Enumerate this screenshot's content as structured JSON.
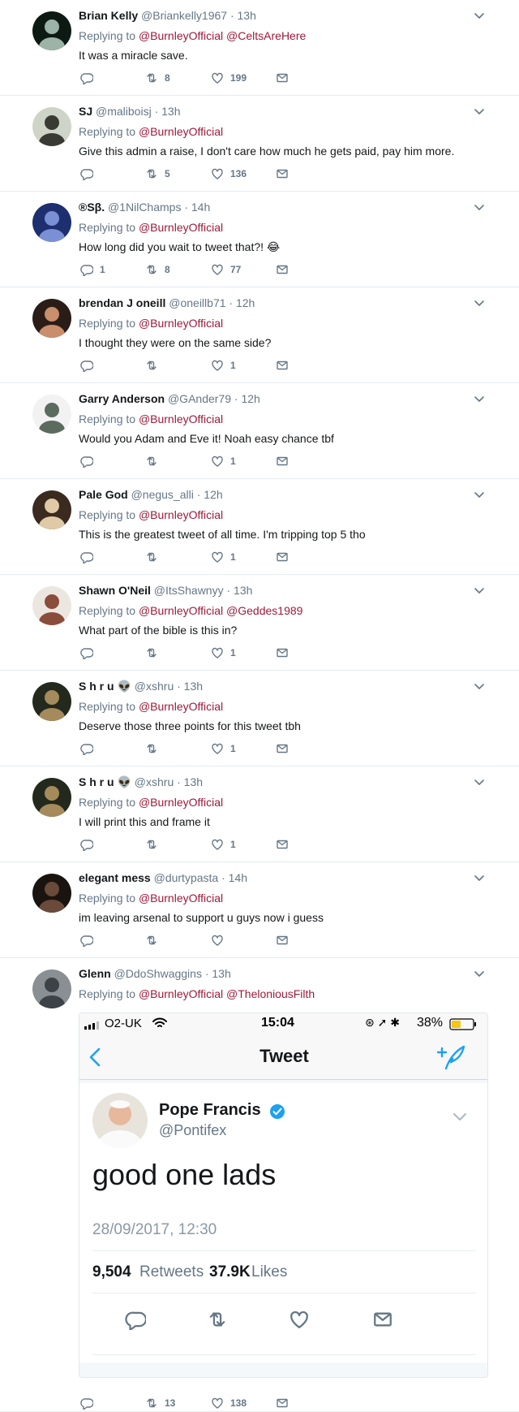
{
  "tweets": [
    {
      "name": "Brian Kelly",
      "handle": "@Briankelly1967 · 13h",
      "replying": "Replying to",
      "mentions": [
        "@BurnleyOfficial",
        "@CeltsAreHere"
      ],
      "text": "It was a miracle save.",
      "replies": "",
      "retweets": "8",
      "likes": "199"
    },
    {
      "name": "SJ",
      "handle": "@maliboisj · 13h",
      "replying": "Replying to",
      "mentions": [
        "@BurnleyOfficial"
      ],
      "text": "Give this admin a raise, I don't care how much he gets paid, pay him more.",
      "replies": "",
      "retweets": "5",
      "likes": "136"
    },
    {
      "name": "®Sβ.",
      "handle": "@1NilChamps · 14h",
      "replying": "Replying to",
      "mentions": [
        "@BurnleyOfficial"
      ],
      "text": "How long did you wait to tweet that?! 😂",
      "replies": "1",
      "retweets": "8",
      "likes": "77"
    },
    {
      "name": "brendan J oneill",
      "handle": "@oneillb71 · 12h",
      "replying": "Replying to",
      "mentions": [
        "@BurnleyOfficial"
      ],
      "text": "I thought they were on the same side?",
      "replies": "",
      "retweets": "",
      "likes": "1"
    },
    {
      "name": "Garry Anderson",
      "handle": "@GAnder79 · 12h",
      "replying": "Replying to",
      "mentions": [
        "@BurnleyOfficial"
      ],
      "text": "Would you Adam and Eve it! Noah easy chance tbf",
      "replies": "",
      "retweets": "",
      "likes": "1"
    },
    {
      "name": "Pale God",
      "handle": "@negus_alli · 12h",
      "replying": "Replying to",
      "mentions": [
        "@BurnleyOfficial"
      ],
      "text": "This is the greatest tweet of all time. I'm tripping top 5 tho",
      "replies": "",
      "retweets": "",
      "likes": "1"
    },
    {
      "name": "Shawn O'Neil",
      "handle": "@ItsShawnyy · 13h",
      "replying": "Replying to",
      "mentions": [
        "@BurnleyOfficial",
        "@Geddes1989"
      ],
      "text": "What part of the bible is this in?",
      "replies": "",
      "retweets": "",
      "likes": "1"
    },
    {
      "name": "S h r u 👽",
      "handle": "@xshru · 13h",
      "replying": "Replying to",
      "mentions": [
        "@BurnleyOfficial"
      ],
      "text": "Deserve those three points for this tweet tbh",
      "replies": "",
      "retweets": "",
      "likes": "1"
    },
    {
      "name": "S h r u 👽",
      "handle": "@xshru · 13h",
      "replying": "Replying to",
      "mentions": [
        "@BurnleyOfficial"
      ],
      "text": "I will print this and frame it",
      "replies": "",
      "retweets": "",
      "likes": "1"
    },
    {
      "name": "elegant mess",
      "handle": "@durtypasta · 14h",
      "replying": "Replying to",
      "mentions": [
        "@BurnleyOfficial"
      ],
      "text": "im leaving arsenal to support u guys now i guess",
      "replies": "",
      "retweets": "",
      "likes": ""
    },
    {
      "name": "Glenn",
      "handle": "@DdoShwaggins · 13h",
      "replying": "Replying to",
      "mentions": [
        "@BurnleyOfficial",
        "@TheloniousFilth"
      ],
      "text": "",
      "replies": "",
      "retweets": "13",
      "likes": "138"
    }
  ],
  "embed": {
    "carrier": "O2-UK",
    "time": "15:04",
    "battery": "38%",
    "nav_title": "Tweet",
    "author_name": "Pope Francis",
    "author_handle": "@Pontifex",
    "body": "good one lads",
    "timestamp": "28/09/2017, 12:30",
    "retweets_count": "9,504",
    "retweets_label": "Retweets",
    "likes_count": "37.9K",
    "likes_label": "Likes",
    "accent": "#1da1f2",
    "verified_color": "#1da1f2"
  },
  "colors": {
    "mention": "#9b1b3a",
    "muted": "#657786",
    "text": "#14171a"
  }
}
